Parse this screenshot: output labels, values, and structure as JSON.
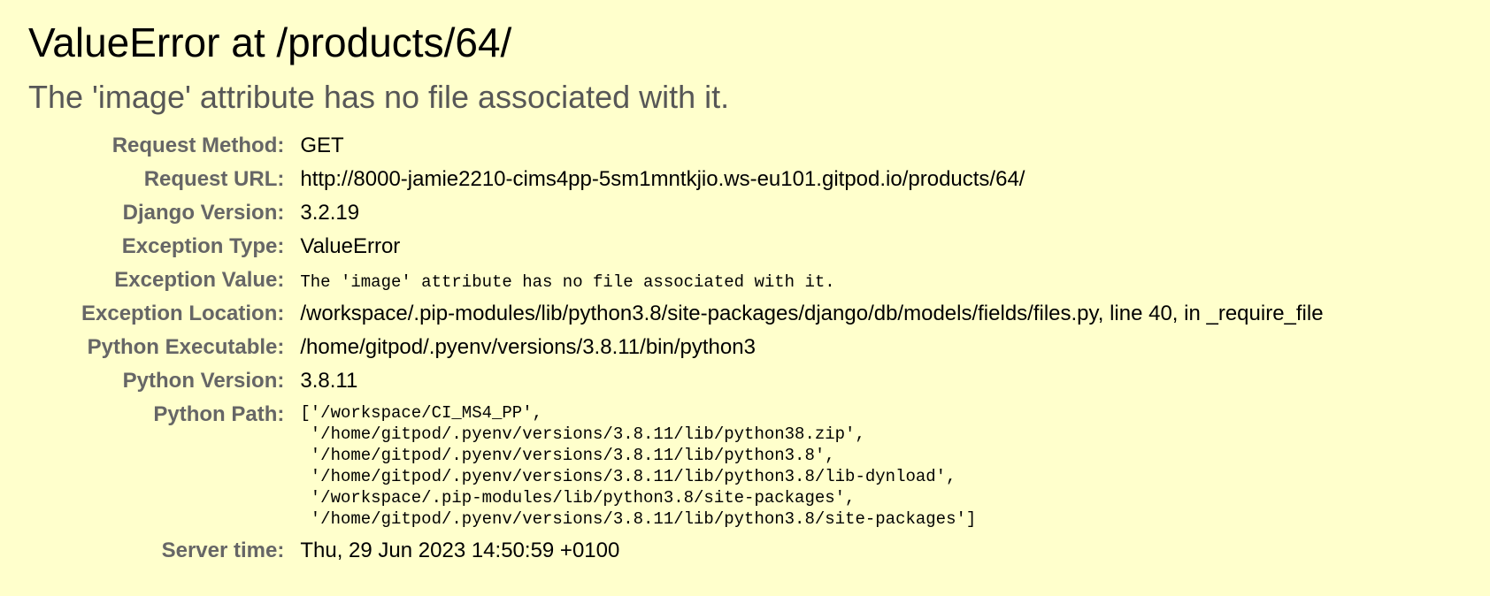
{
  "title": "ValueError at /products/64/",
  "subtitle": "The 'image' attribute has no file associated with it.",
  "meta": {
    "request_method": {
      "label": "Request Method:",
      "value": "GET"
    },
    "request_url": {
      "label": "Request URL:",
      "value": "http://8000-jamie2210-cims4pp-5sm1mntkjio.ws-eu101.gitpod.io/products/64/"
    },
    "django_version": {
      "label": "Django Version:",
      "value": "3.2.19"
    },
    "exception_type": {
      "label": "Exception Type:",
      "value": "ValueError"
    },
    "exception_value": {
      "label": "Exception Value:",
      "value": "The 'image' attribute has no file associated with it."
    },
    "exception_location": {
      "label": "Exception Location:",
      "value": "/workspace/.pip-modules/lib/python3.8/site-packages/django/db/models/fields/files.py, line 40, in _require_file"
    },
    "python_executable": {
      "label": "Python Executable:",
      "value": "/home/gitpod/.pyenv/versions/3.8.11/bin/python3"
    },
    "python_version": {
      "label": "Python Version:",
      "value": "3.8.11"
    },
    "python_path": {
      "label": "Python Path:",
      "lines": [
        "['/workspace/CI_MS4_PP',",
        " '/home/gitpod/.pyenv/versions/3.8.11/lib/python38.zip',",
        " '/home/gitpod/.pyenv/versions/3.8.11/lib/python3.8',",
        " '/home/gitpod/.pyenv/versions/3.8.11/lib/python3.8/lib-dynload',",
        " '/workspace/.pip-modules/lib/python3.8/site-packages',",
        " '/home/gitpod/.pyenv/versions/3.8.11/lib/python3.8/site-packages']"
      ]
    },
    "server_time": {
      "label": "Server time:",
      "value": "Thu, 29 Jun 2023 14:50:59 +0100"
    }
  }
}
